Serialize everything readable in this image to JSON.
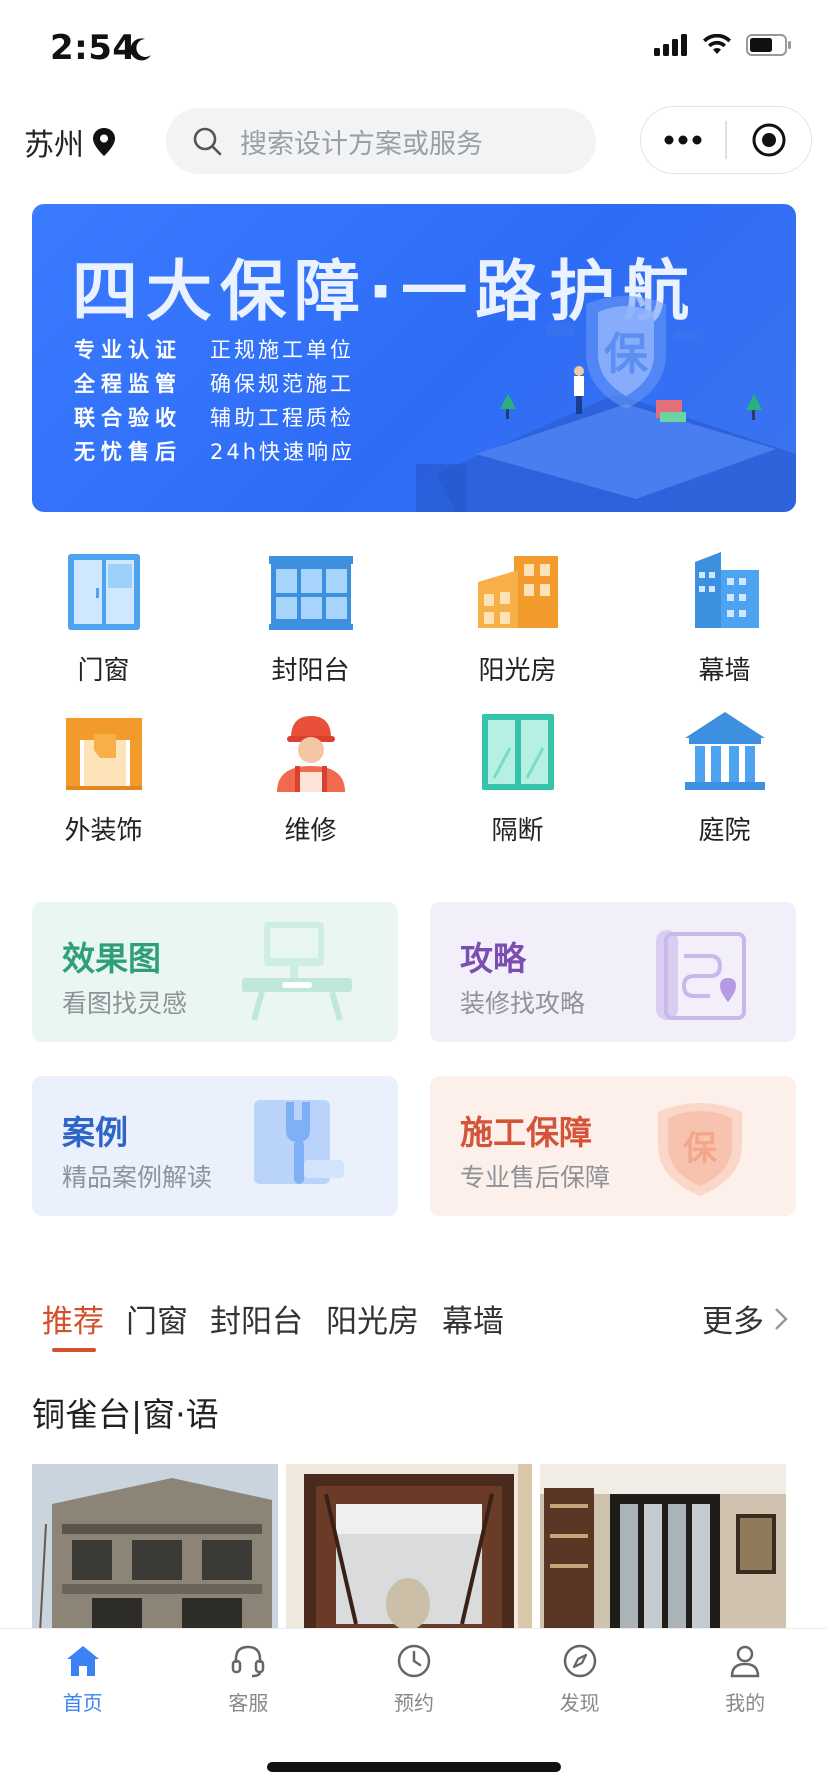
{
  "status_bar": {
    "time": "2:54"
  },
  "header": {
    "city": "苏州",
    "search_placeholder": "搜索设计方案或服务"
  },
  "banner": {
    "title": "四大保障·一路护航",
    "lines": [
      {
        "key": "专业认证",
        "value": "正规施工单位"
      },
      {
        "key": "全程监管",
        "value": "确保规范施工"
      },
      {
        "key": "联合验收",
        "value": "辅助工程质检"
      },
      {
        "key": "无忧售后",
        "value": "24h快速响应"
      }
    ],
    "shield_text": "保"
  },
  "categories": [
    {
      "label": "门窗",
      "icon": "door-window-icon"
    },
    {
      "label": "封阳台",
      "icon": "balcony-icon"
    },
    {
      "label": "阳光房",
      "icon": "sunroom-icon"
    },
    {
      "label": "幕墙",
      "icon": "curtain-wall-icon"
    },
    {
      "label": "外装饰",
      "icon": "exterior-decor-icon"
    },
    {
      "label": "维修",
      "icon": "repair-worker-icon"
    },
    {
      "label": "隔断",
      "icon": "partition-icon"
    },
    {
      "label": "庭院",
      "icon": "courtyard-icon"
    }
  ],
  "cards": [
    {
      "title": "效果图",
      "subtitle": "看图找灵感",
      "title_color": "#2f9e7a",
      "bg": "#eaf7f1"
    },
    {
      "title": "攻略",
      "subtitle": "装修找攻略",
      "title_color": "#7b4fb0",
      "bg": "#f2effb"
    },
    {
      "title": "案例",
      "subtitle": "精品案例解读",
      "title_color": "#2f64c9",
      "bg": "#eaf1fd"
    },
    {
      "title": "施工保障",
      "subtitle": "专业售后保障",
      "title_color": "#d4543a",
      "bg": "#fdf0ea"
    }
  ],
  "card_art_text": "保",
  "tabs": {
    "items": [
      "推荐",
      "门窗",
      "封阳台",
      "阳光房",
      "幕墙"
    ],
    "more": "更多"
  },
  "section_title": "铜雀台|窗·语",
  "bottom_nav": [
    {
      "label": "首页",
      "icon": "home-icon"
    },
    {
      "label": "客服",
      "icon": "headset-icon"
    },
    {
      "label": "预约",
      "icon": "clock-icon"
    },
    {
      "label": "发现",
      "icon": "compass-icon"
    },
    {
      "label": "我的",
      "icon": "profile-icon"
    }
  ],
  "colors": {
    "accent": "#3b82f6",
    "tab_active": "#d2502b",
    "banner_bg": "#2e6cf6"
  }
}
